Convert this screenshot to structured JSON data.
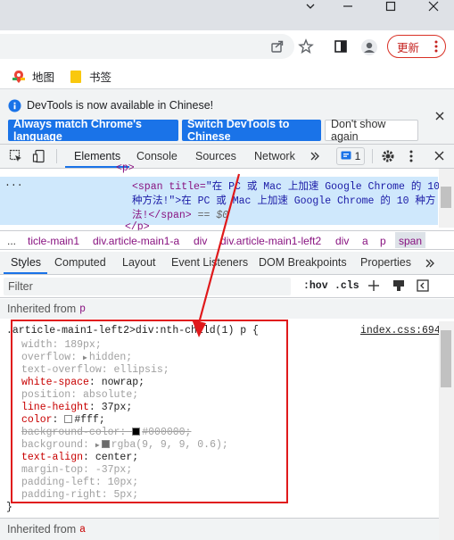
{
  "window": {
    "min_icon": "chevron-down",
    "restore_icon": "restore",
    "close_icon": "close"
  },
  "bookmarks": [
    {
      "label": "地图"
    },
    {
      "label": "书签"
    }
  ],
  "toolbar": {
    "update_label": "更新"
  },
  "infobar": {
    "message": "DevTools is now available in Chinese!",
    "btn_match": "Always match Chrome's language",
    "btn_switch": "Switch DevTools to Chinese",
    "btn_dont": "Don't show again"
  },
  "devtools_tabs": [
    "Elements",
    "Console",
    "Sources",
    "Network"
  ],
  "issues_count": "1",
  "elements": {
    "line0": "<p>",
    "line1_tag": "<span title=",
    "line1_attr": "\"在 PC 或 Mac 上加速 Google Chrome 的 10",
    "line2": "种方法!\">在 PC 或 Mac 上加速 Google Chrome 的 10 种方",
    "line3": "法!</span>",
    "line3_eq": "== $0",
    "line4": "</p>",
    "dots": "..."
  },
  "breadcrumbs": [
    "...",
    "ticle-main1",
    "div.article-main1-a",
    "div",
    "div.article-main1-left2",
    "div",
    "a",
    "p",
    "span"
  ],
  "style_tabs": [
    "Styles",
    "Computed",
    "Layout",
    "Event Listeners",
    "DOM Breakpoints",
    "Properties"
  ],
  "filter": {
    "placeholder": "Filter",
    "hov": ":hov",
    "cls": ".cls"
  },
  "inherited1": {
    "label": "Inherited from",
    "tag": "p"
  },
  "rule": {
    "selector": ".article-main1-left2>div:nth-child(1) p {",
    "source": "index.css:694",
    "close": "}",
    "props": [
      {
        "name": "width",
        "value": "189px;",
        "faded": true,
        "struck": false
      },
      {
        "name": "overflow",
        "value": "hidden;",
        "faded": true,
        "struck": false,
        "arrow": true
      },
      {
        "name": "text-overflow",
        "value": "ellipsis;",
        "faded": true,
        "struck": false
      },
      {
        "name": "white-space",
        "value": "nowrap;",
        "faded": false,
        "struck": false
      },
      {
        "name": "position",
        "value": "absolute;",
        "faded": true,
        "struck": false
      },
      {
        "name": "line-height",
        "value": "37px;",
        "faded": false,
        "struck": false
      },
      {
        "name": "color",
        "value": "#fff;",
        "faded": false,
        "struck": false,
        "swatch": "#ffffff"
      },
      {
        "name": "background-color",
        "value": "#000000;",
        "faded": true,
        "struck": true,
        "swatch": "#000000"
      },
      {
        "name": "background",
        "value": "rgba(9, 9, 9, 0.6);",
        "faded": true,
        "struck": false,
        "arrow": true,
        "swatch": "rgba(9,9,9,0.6)"
      },
      {
        "name": "text-align",
        "value": "center;",
        "faded": false,
        "struck": false
      },
      {
        "name": "margin-top",
        "value": "-37px;",
        "faded": true,
        "struck": false
      },
      {
        "name": "padding-left",
        "value": "10px;",
        "faded": true,
        "struck": false
      },
      {
        "name": "padding-right",
        "value": "5px;",
        "faded": true,
        "struck": false
      }
    ]
  },
  "inherited2": {
    "label": "Inherited from",
    "tag": "a"
  },
  "colors": {
    "highlight": "#e22",
    "annotation_red": "#e0191b",
    "accent": "#1a73e8"
  }
}
